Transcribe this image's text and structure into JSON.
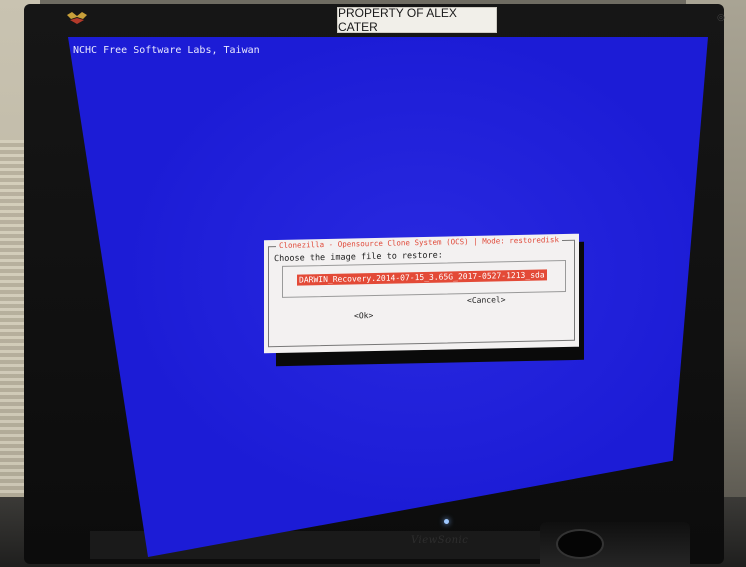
{
  "sticker": {
    "text": "PROPERTY OF ALEX CATER"
  },
  "screen": {
    "header": "NCHC Free Software Labs, Taiwan",
    "background_color": "#1c1cd6"
  },
  "dialog": {
    "title": "Clonezilla - Opensource Clone System (OCS) | Mode: restoredisk",
    "prompt": "Choose the image file to restore:",
    "selected_item": "DARWIN_Recovery.2014-07-15_3.65G_2017-0527-1213_sda",
    "ok_label": "<Ok>",
    "cancel_label": "<Cancel>",
    "highlight_color": "#e34a37"
  },
  "monitor": {
    "brand": "ViewSonic"
  }
}
